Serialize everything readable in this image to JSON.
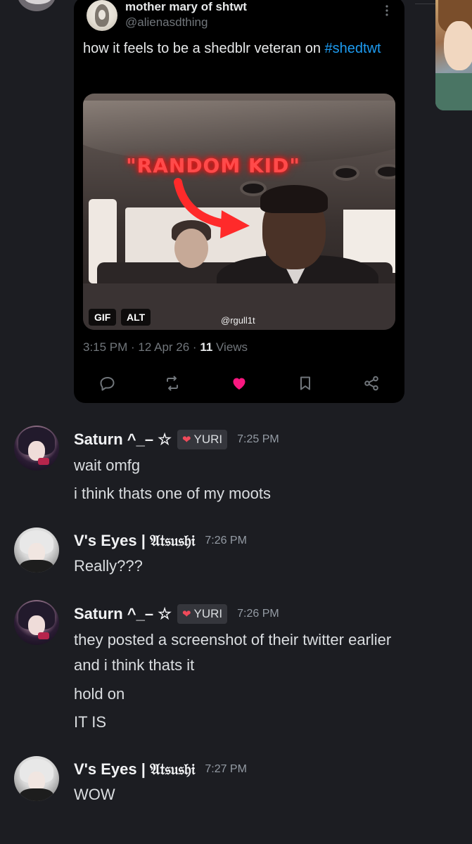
{
  "tweet": {
    "author_name": "mother mary of shtwt",
    "author_handle": "@alienasdthing",
    "more_icon": "more-vertical-icon",
    "text_main": "how it feels to be a shedblr veteran on ",
    "hashtag": "#shedtwt",
    "media": {
      "overlay_text": "\"RANDOM KID\"",
      "gif_badge": "GIF",
      "alt_badge": "ALT",
      "watermark": "@rgull1t"
    },
    "timestamp": "3:15 PM · 12 Apr 26 · ",
    "views_count": "11",
    "views_label": " Views",
    "actions": [
      "reply-icon",
      "retweet-icon",
      "like-icon",
      "bookmark-icon",
      "share-icon"
    ],
    "colors": {
      "hashtag": "#1d9bf0",
      "like": "#f91880",
      "card_bg": "#000000"
    }
  },
  "messages": [
    {
      "username": "Saturn ^_– ☆",
      "role_tag": "YURI",
      "time": "7:25 PM",
      "lines": [
        "wait omfg",
        "i think thats one of my moots"
      ]
    },
    {
      "username": "V's Eyes | 𝔄𝔱𝔰𝔲𝔰𝔥𝔦",
      "time": "7:26 PM",
      "lines": [
        "Really???"
      ]
    },
    {
      "username": "Saturn ^_– ☆",
      "role_tag": "YURI",
      "time": "7:26 PM",
      "lines": [
        "they posted a screenshot of their twitter earlier",
        "and i think thats it",
        "hold on",
        "IT IS"
      ]
    },
    {
      "username": "V's Eyes | 𝔄𝔱𝔰𝔲𝔰𝔥𝔦",
      "time": "7:27 PM",
      "lines": [
        "WOW"
      ]
    }
  ],
  "colors": {
    "background": "#1c1d22",
    "timestamp": "#949ba4",
    "role_heart": "#f04a5a"
  }
}
